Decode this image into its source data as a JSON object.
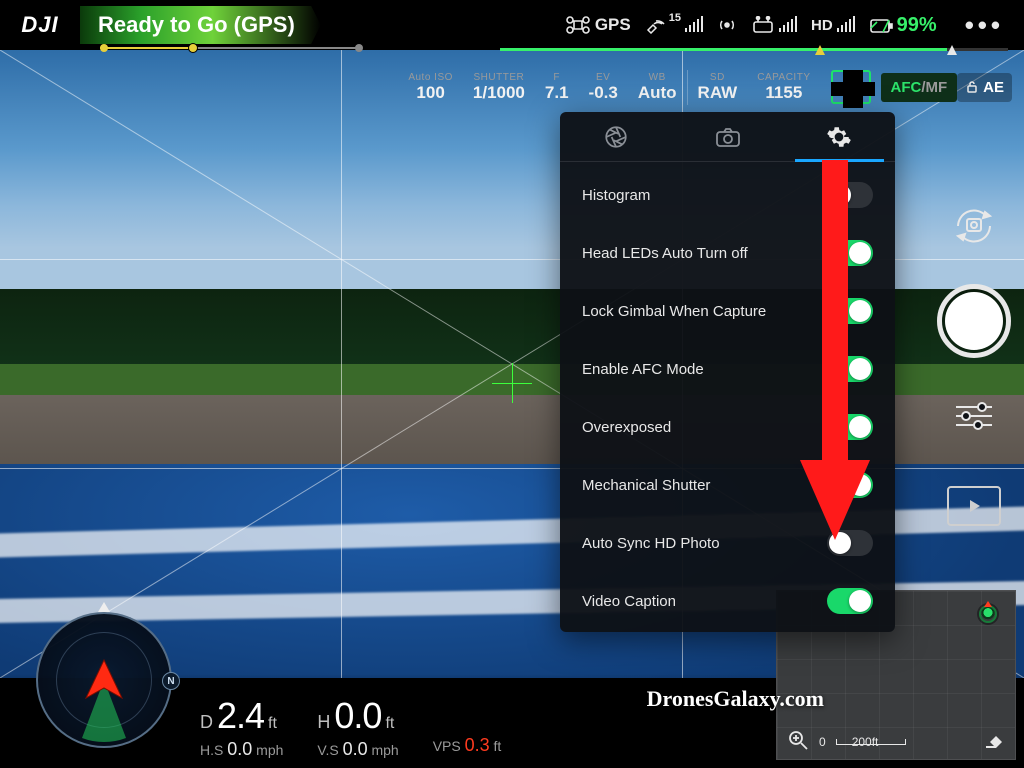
{
  "top": {
    "logo": "DJI",
    "status": "Ready to Go (GPS)",
    "gps_label": "GPS",
    "sat_count": "15",
    "battery_pct": "99%",
    "hd_label": "HD",
    "more": "•••"
  },
  "exposure": {
    "iso_lbl": "Auto ISO",
    "iso_val": "100",
    "shutter_lbl": "SHUTTER",
    "shutter_val": "1/1000",
    "f_lbl": "F",
    "f_val": "7.1",
    "ev_lbl": "EV",
    "ev_val": "-0.3",
    "wb_lbl": "WB",
    "wb_val": "Auto",
    "fmt_lbl": "SD",
    "fmt_val": "RAW",
    "cap_lbl": "CAPACITY",
    "cap_val": "1155",
    "afc": "AFC",
    "mf": "/MF",
    "ae": "AE"
  },
  "settings": {
    "items": [
      {
        "label": "Histogram",
        "on": false
      },
      {
        "label": "Head LEDs Auto Turn off",
        "on": true
      },
      {
        "label": "Lock Gimbal When Capture",
        "on": true
      },
      {
        "label": "Enable AFC Mode",
        "on": true
      },
      {
        "label": "Overexposed",
        "on": true
      },
      {
        "label": "Mechanical Shutter",
        "on": true
      },
      {
        "label": "Auto Sync HD Photo",
        "on": false
      },
      {
        "label": "Video Caption",
        "on": true
      }
    ]
  },
  "telemetry": {
    "d_pre": "D",
    "d_val": "2.4",
    "d_unit": "ft",
    "h_pre": "H",
    "h_val": "0.0",
    "h_unit": "ft",
    "hs_lbl": "H.S",
    "hs_val": "0.0",
    "hs_unit": "mph",
    "vs_lbl": "V.S",
    "vs_val": "0.0",
    "vs_unit": "mph",
    "vps_lbl": "VPS",
    "vps_val": "0.3",
    "vps_unit": "ft"
  },
  "minimap": {
    "scale_a": "0",
    "scale_b": "200ft"
  },
  "radar": {
    "n": "N"
  },
  "watermark": "DronesGalaxy.com"
}
